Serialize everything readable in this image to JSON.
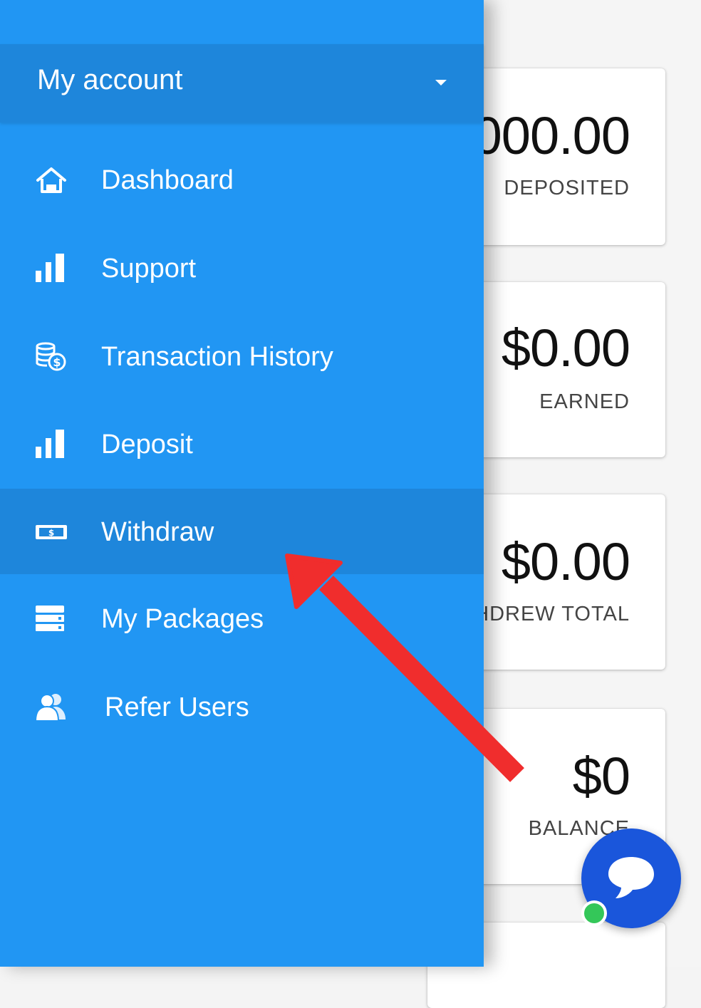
{
  "drawer": {
    "account_label": "My account",
    "items": [
      {
        "label": "Dashboard",
        "icon": "home-icon"
      },
      {
        "label": "Support",
        "icon": "bar-chart-icon"
      },
      {
        "label": "Transaction History",
        "icon": "coins-icon"
      },
      {
        "label": "Deposit",
        "icon": "bar-chart-icon"
      },
      {
        "label": "Withdraw",
        "icon": "money-bill-icon",
        "active": true
      },
      {
        "label": "My Packages",
        "icon": "server-icon"
      },
      {
        "label": "Refer Users",
        "icon": "users-icon"
      }
    ]
  },
  "cards": [
    {
      "value": "000.00",
      "label": "DEPOSITED"
    },
    {
      "value": "$0.00",
      "label": "EARNED"
    },
    {
      "value": "$0.00",
      "label": "HDREW TOTAL"
    },
    {
      "value": "$0",
      "label": "BALANCE"
    }
  ],
  "colors": {
    "drawer_bg": "#2196f3",
    "drawer_active": "#1e86db",
    "arrow": "#f02d2d",
    "chat_button": "#1a56db",
    "online_dot": "#34c759"
  },
  "chat": {
    "icon": "chat-bubble-icon"
  }
}
